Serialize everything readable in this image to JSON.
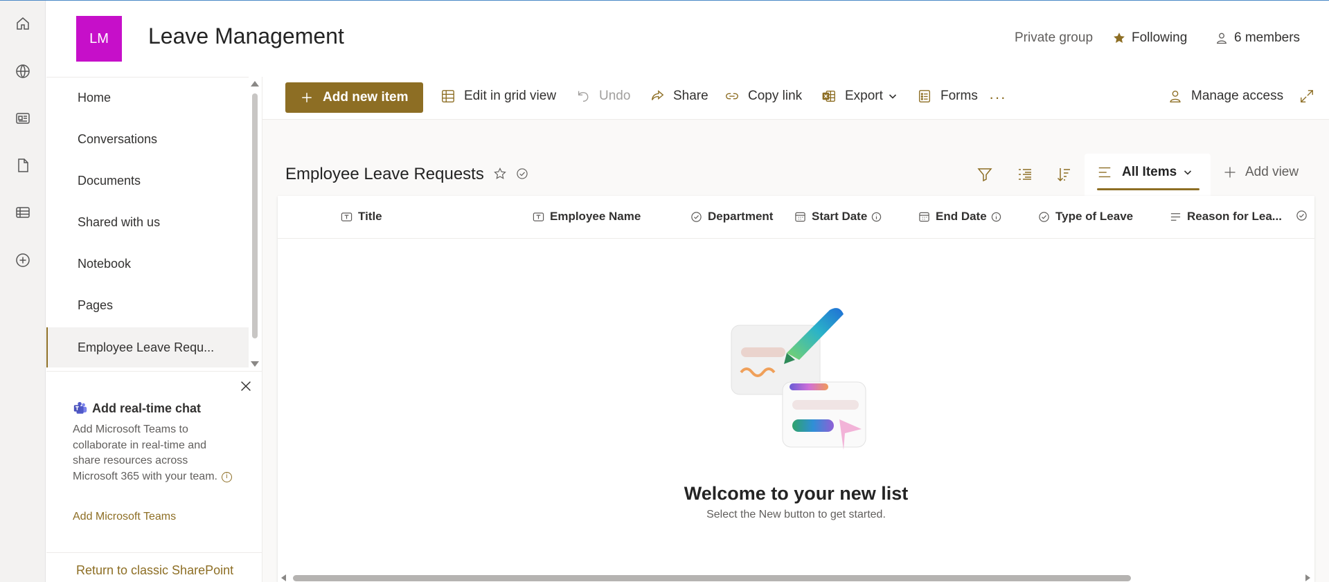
{
  "site": {
    "logo_initials": "LM",
    "logo_color": "#c60fc9",
    "title": "Leave Management",
    "privacy": "Private group",
    "following": "Following",
    "members": "6 members"
  },
  "rail": {
    "icons": [
      "home-icon",
      "globe-icon",
      "news-icon",
      "file-icon",
      "list-icon",
      "add-circle-icon"
    ]
  },
  "nav": {
    "items": [
      {
        "label": "Home"
      },
      {
        "label": "Conversations"
      },
      {
        "label": "Documents"
      },
      {
        "label": "Shared with us"
      },
      {
        "label": "Notebook"
      },
      {
        "label": "Pages"
      },
      {
        "label": "Employee Leave Requ..."
      }
    ],
    "active_index": 6
  },
  "teams_promo": {
    "title": "Add real-time chat",
    "body": "Add Microsoft Teams to collaborate in real-time and share resources across Microsoft 365 with your team.",
    "link": "Add Microsoft Teams"
  },
  "classic_link": "Return to classic SharePoint",
  "commands": {
    "add_new": "Add new item",
    "edit_grid": "Edit in grid view",
    "undo": "Undo",
    "share": "Share",
    "copy_link": "Copy link",
    "export": "Export",
    "forms": "Forms",
    "more": "···",
    "manage_access": "Manage access"
  },
  "list": {
    "title": "Employee Leave Requests",
    "current_view": "All Items",
    "add_view": "Add view",
    "columns": [
      {
        "label": "Title",
        "icon": "text-icon"
      },
      {
        "label": "Employee Name",
        "icon": "text-icon"
      },
      {
        "label": "Department",
        "icon": "choice-icon"
      },
      {
        "label": "Start Date",
        "icon": "calendar-icon",
        "info": true
      },
      {
        "label": "End Date",
        "icon": "calendar-icon",
        "info": true
      },
      {
        "label": "Type of Leave",
        "icon": "choice-icon"
      },
      {
        "label": "Reason for Lea...",
        "icon": "multiline-icon"
      }
    ],
    "empty_title": "Welcome to your new list",
    "empty_subtitle": "Select the New button to get started."
  },
  "colors": {
    "accent": "#8d6e24",
    "nav_active_bg": "#f3f2f1",
    "content_bg": "#faf9f8"
  }
}
